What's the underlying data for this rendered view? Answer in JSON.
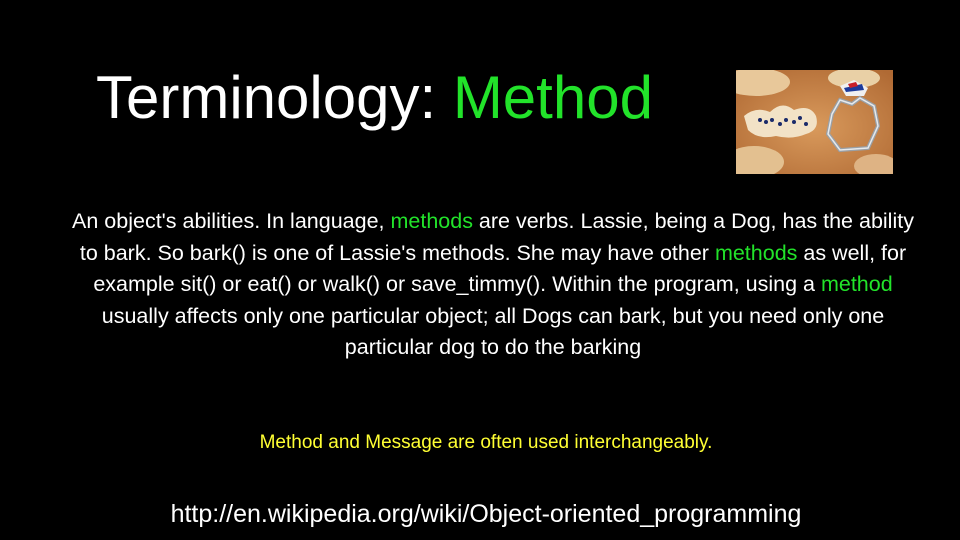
{
  "slide": {
    "title_prefix": "Terminology: ",
    "title_accent": "Method",
    "image_description_name": "cookie-cutter-photo",
    "body": {
      "s1": "An object's abilities. In language, ",
      "m1": "methods",
      "s2": " are verbs. Lassie, being a Dog, has the ability to bark. So bark() is one of Lassie's methods. She may have other ",
      "m2": "methods",
      "s3": " as well, for example sit() or eat() or walk() or save_timmy(). Within the program, using a ",
      "m3": "method",
      "s4": " usually affects only one particular object; all Dogs can bark, but you need only one particular dog to do the barking"
    },
    "note": "Method and Message are often used interchangeably.",
    "link": "http://en.wikipedia.org/wiki/Object-oriented_programming"
  },
  "colors": {
    "background": "#000000",
    "text": "#ffffff",
    "accent_green": "#22e32a",
    "note_yellow": "#ffff33"
  }
}
